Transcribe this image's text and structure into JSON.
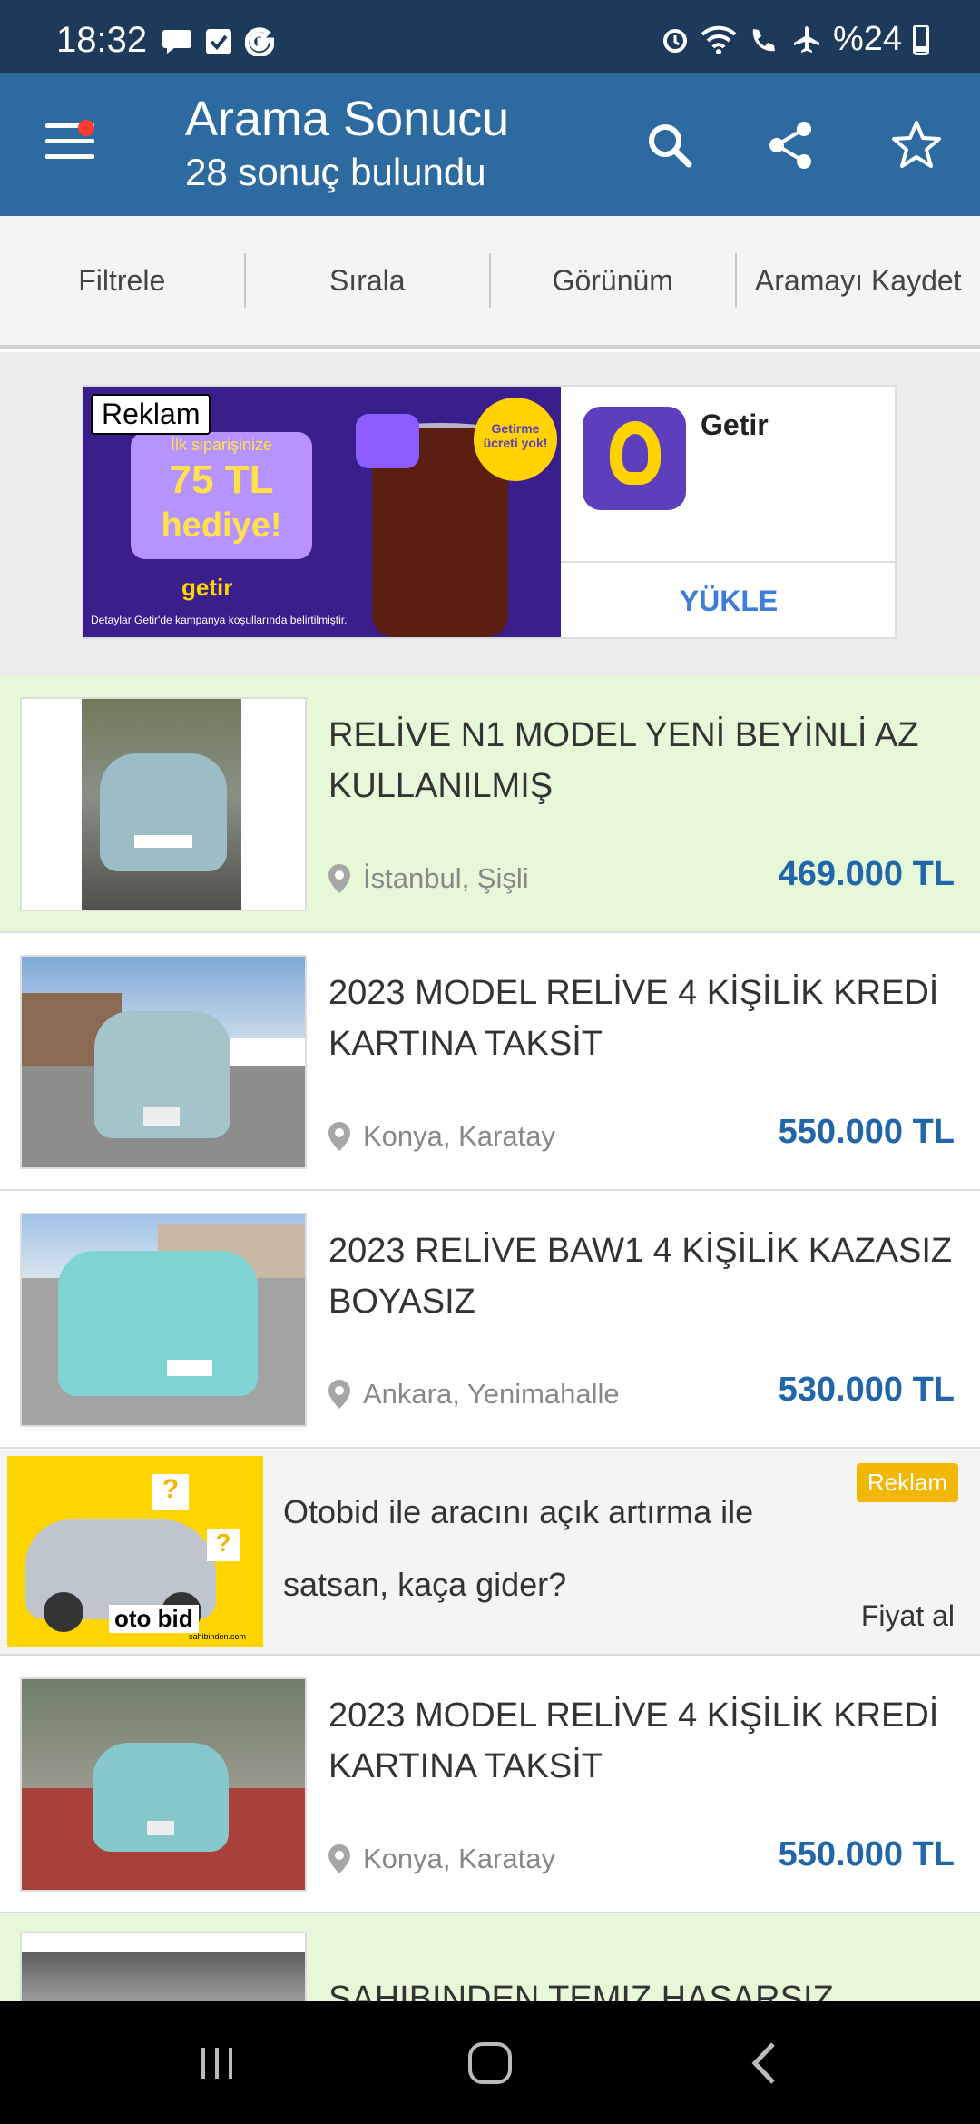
{
  "status_bar": {
    "time": "18:32",
    "left_icons": [
      "chat-icon",
      "checkbox-icon",
      "google-icon"
    ],
    "right_icons": [
      "alarm-icon",
      "wifi-icon",
      "wifi-calling-icon",
      "airplane-icon"
    ],
    "battery": "%24"
  },
  "app_bar": {
    "title": "Arama Sonucu",
    "subtitle": "28 sonuç bulundu",
    "actions": [
      "search-icon",
      "share-icon",
      "star-icon"
    ]
  },
  "toolbar": {
    "filter": "Filtrele",
    "sort": "Sırala",
    "view": "Görünüm",
    "save_search": "Aramayı Kaydet"
  },
  "top_ad": {
    "tag": "Reklam",
    "banner_small": "İlk siparişinize",
    "banner_amount": "75 TL",
    "banner_gift": "hediye!",
    "banner_brand": "getir",
    "banner_badge": "Getirme ücreti yok!",
    "banner_disclaimer": "Detaylar Getir'de kampanya koşullarında belirtilmiştir.",
    "app_name": "Getir",
    "install_label": "YÜKLE",
    "colors": {
      "banner_bg": "#3a1e8c",
      "brand_yellow": "#ffd300",
      "install": "#3b7dd8"
    }
  },
  "listings": [
    {
      "title": "RELİVE N1 MODEL YENİ BEYİNLİ AZ KULLANILMIŞ",
      "location": "İstanbul, Şişli",
      "price": "469.000 TL",
      "featured": true
    },
    {
      "title": "2023 MODEL RELİVE 4 KİŞİLİK KREDİ KARTINA TAKSİT",
      "location": "Konya, Karatay",
      "price": "550.000 TL",
      "featured": false
    },
    {
      "title": "2023 RELİVE BAW1 4 KİŞİLİK KAZASIZ BOYASIZ",
      "location": "Ankara, Yenimahalle",
      "price": "530.000 TL",
      "featured": false
    },
    {
      "title": "2023 MODEL RELİVE 4 KİŞİLİK KREDİ KARTINA TAKSİT",
      "location": "Konya, Karatay",
      "price": "550.000 TL",
      "featured": false
    },
    {
      "title": "SAHIBINDEN TEMIZ HASARSIZ",
      "featured": true
    }
  ],
  "otobid_ad": {
    "text": "Otobid ile aracını açık artırma ile satsan, kaça gider?",
    "tag": "Reklam",
    "cta": "Fiyat al",
    "logo": "oto bid",
    "logo_sub": "sahibinden.com"
  },
  "nav_bar": {
    "items": [
      "recent-apps-icon",
      "home-icon",
      "back-icon"
    ]
  },
  "colors": {
    "status_bar": "#1e3a5a",
    "app_bar": "#2d6aa0",
    "price": "#2166a8",
    "featured_bg": "#e6f8d8",
    "ad_tag": "#f2b705"
  }
}
